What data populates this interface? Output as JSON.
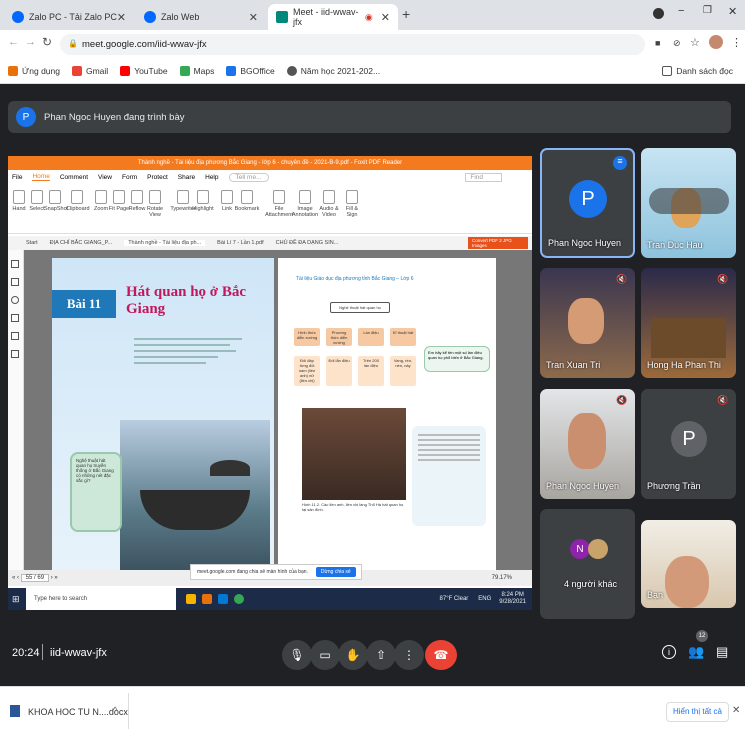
{
  "browser": {
    "tabs": [
      {
        "label": "Zalo PC - Tải Zalo PC để làm việc",
        "icon": "zalo-icon"
      },
      {
        "label": "Zalo Web",
        "icon": "zalo-icon"
      },
      {
        "label": "Meet - iid-wwav-jfx",
        "icon": "meet-icon",
        "active": true
      }
    ],
    "url": "meet.google.com/iid-wwav-jfx",
    "bookmarks": [
      {
        "label": "Ứng dụng",
        "icon": "apps-icon",
        "color": "#e8710a"
      },
      {
        "label": "Gmail",
        "icon": "gmail-icon",
        "color": "#ea4335"
      },
      {
        "label": "YouTube",
        "icon": "youtube-icon",
        "color": "#ff0000"
      },
      {
        "label": "Maps",
        "icon": "maps-icon",
        "color": "#34a853"
      },
      {
        "label": "BGOffice",
        "icon": "bgoffice-icon",
        "color": "#1a73e8"
      },
      {
        "label": "Năm học 2021-202...",
        "icon": "globe-icon",
        "color": "#555555"
      }
    ],
    "reading_list": "Danh sách đọc"
  },
  "meet": {
    "presenter_initial": "P",
    "presenter_banner": "Phan Ngoc Huyen đang trình bày",
    "time": "20:24",
    "meeting_code": "iid-wwav-jfx",
    "participant_count": "12",
    "participants": [
      {
        "name": "Phan Ngoc Huyen",
        "initial": "P",
        "type": "avatar",
        "color": "#1a73e8",
        "speaking": true
      },
      {
        "name": "Tran Duc Hau",
        "type": "video"
      },
      {
        "name": "Tran Xuan Tri",
        "type": "video",
        "muted": true
      },
      {
        "name": "Hong Ha Phan Thi",
        "type": "video",
        "muted": true
      },
      {
        "name": "Phan Ngoc Huyen",
        "type": "video",
        "muted": true
      },
      {
        "name": "Phương Trần",
        "initial": "P",
        "type": "avatar",
        "color": "#5f6368",
        "muted": true
      },
      {
        "name": "4 người khác",
        "initial": "N",
        "type": "group",
        "color": "#8e24aa"
      },
      {
        "name": "Bạn",
        "type": "video"
      }
    ]
  },
  "shared_screen": {
    "app_title": "Thành nghề - Tài liệu địa phương Bắc Giang - lớp 6 - chuyên đề - 2021-B-9.pdf - Foxit PDF Reader",
    "menu": [
      "File",
      "Home",
      "Comment",
      "View",
      "Form",
      "Protect",
      "Share",
      "Help"
    ],
    "tell_me": "Tell me...",
    "find": "Find",
    "tools": [
      "Hand",
      "Select",
      "SnapShot",
      "Clipboard",
      "Zoom",
      "Fit Page",
      "Reflow",
      "Rotate View",
      "Typewriter",
      "Highlight",
      "Link",
      "Bookmark",
      "File Attachment",
      "Image Annotation",
      "Audio & Video",
      "Fill & Sign"
    ],
    "doc_tabs": [
      "Start",
      "ĐỊA CHỈ BẮC GIANG_P...",
      "Thành nghề - Tài liệu địa ph...",
      "Bài Lí 7 - Lần 1.pdf",
      "CHỦ ĐỀ ĐA DẠNG SIN..."
    ],
    "convert_label": "Convert PDF 2 JPG Images",
    "lesson_badge": "Bài 11",
    "lesson_title": "Hát quan họ ở Bắc Giang",
    "right_page_header": "Tài liệu Giáo dục địa phương tỉnh Bắc Giang – Lớp 6",
    "tree_root": "Nghệ thuật hát quan họ",
    "tree_children": [
      "Hình thức diễn xướng",
      "Phương thức diễn xướng",
      "Làn điệu",
      "Kĩ thuật hát"
    ],
    "tree_leaves": [
      "Đối đáp từng đôi nam (liền anh) nữ (liền chị)",
      "Đối lẫn điệu",
      "Trên 200 làn điệu",
      "Vang, rền, nền, nảy"
    ],
    "question_right": "Em hãy kể tên một số làn điệu quan họ phổ biến ở Bắc Giang.",
    "photo_caption": "Hình 11.2. Các liền anh, liền chị làng Thổ Hà hát quan họ tại sân đình.",
    "left_note": "Nghệ thuật hát quan họ truyền thống ở Bắc Giang có những nét đặc sắc gì?",
    "page_indicator": "55 / 69",
    "zoom": "79.17%",
    "share_notice": "meet.google.com đang chia sẻ màn hình của bạn.",
    "stop_share": "Dừng chia sẻ",
    "search_placeholder": "Type here to search",
    "weather": "87°F Clear",
    "lang": "ENG",
    "clock_time": "8:24 PM",
    "clock_date": "9/28/2021"
  },
  "downloads": {
    "file": "KHOA HOC TU N....docx",
    "show_all": "Hiển thị tất cả"
  }
}
